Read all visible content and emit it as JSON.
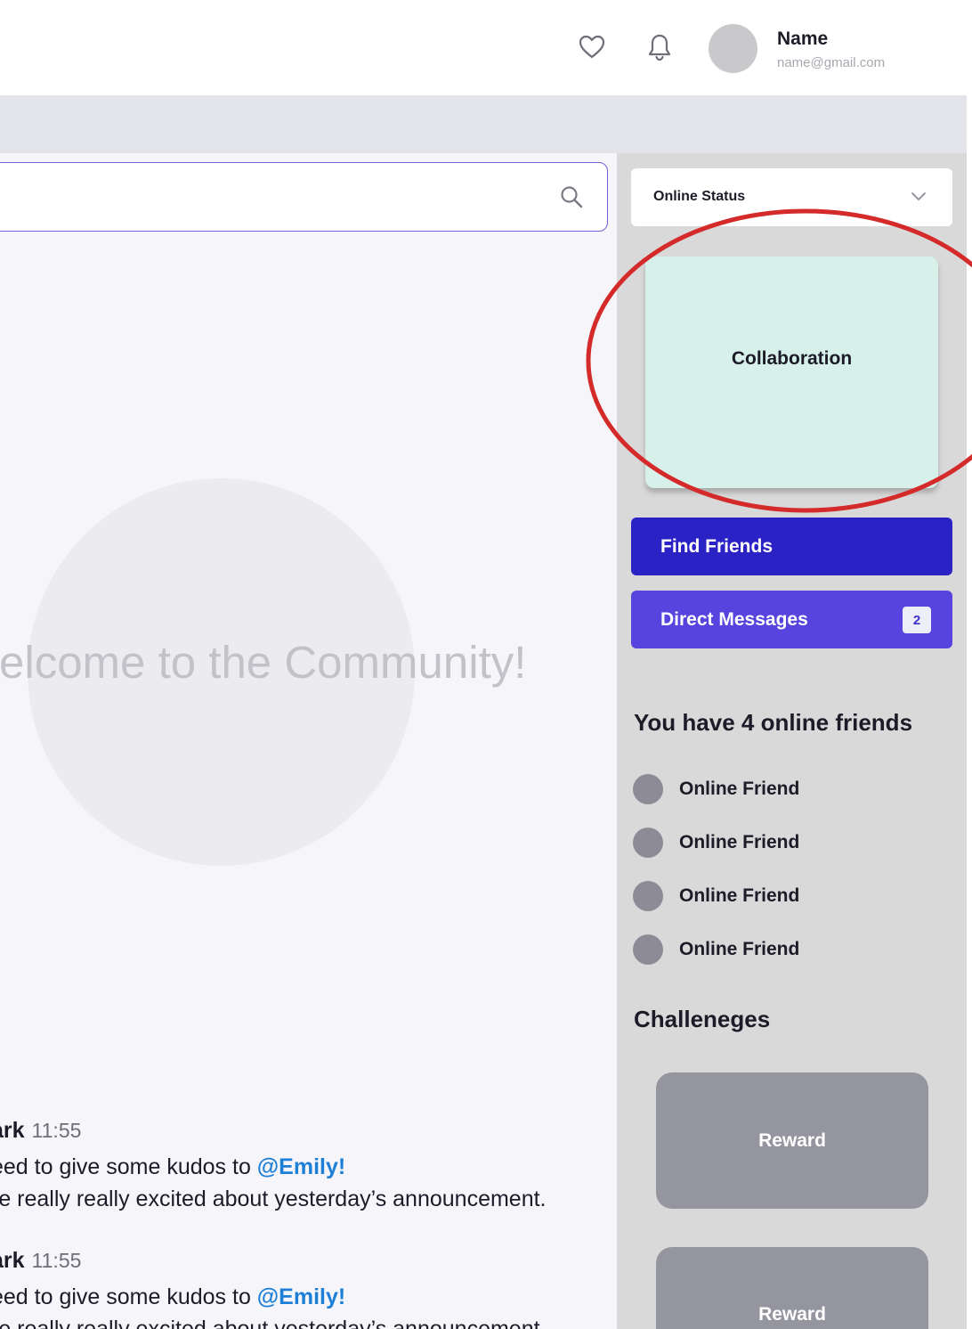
{
  "header": {
    "user_name": "Name",
    "user_email": "name@gmail.com",
    "icons": [
      "heart-icon",
      "bell-icon"
    ]
  },
  "main": {
    "welcome_text": "elcome to the Community!",
    "messages": [
      {
        "author": "ark",
        "time": "11:55",
        "line1_prefix": "eed to give some kudos to ",
        "mention": "@Emily!",
        "line2": "re really really excited about yesterday’s announcement."
      },
      {
        "author": "ark",
        "time": "11:55",
        "line1_prefix": "eed to give some kudos to ",
        "mention": "@Emily!",
        "line2": "re really really excited about yesterday’s announcement."
      }
    ]
  },
  "sidebar": {
    "status_select": "Online Status",
    "collaboration": "Collaboration",
    "find_friends": "Find Friends",
    "direct_messages": "Direct Messages",
    "dm_badge": "2",
    "online_heading": "You have 4 online friends",
    "friends": [
      "Online Friend",
      "Online Friend",
      "Online Friend",
      "Online Friend"
    ],
    "challenges_heading": "Challeneges",
    "rewards": [
      "Reward",
      "Reward"
    ]
  },
  "colors": {
    "primary": "#2b22c6",
    "secondary": "#5743de",
    "mention": "#1d7fd6",
    "collab_card": "#d8f0ea",
    "annotation_ring": "#d42a2a"
  }
}
